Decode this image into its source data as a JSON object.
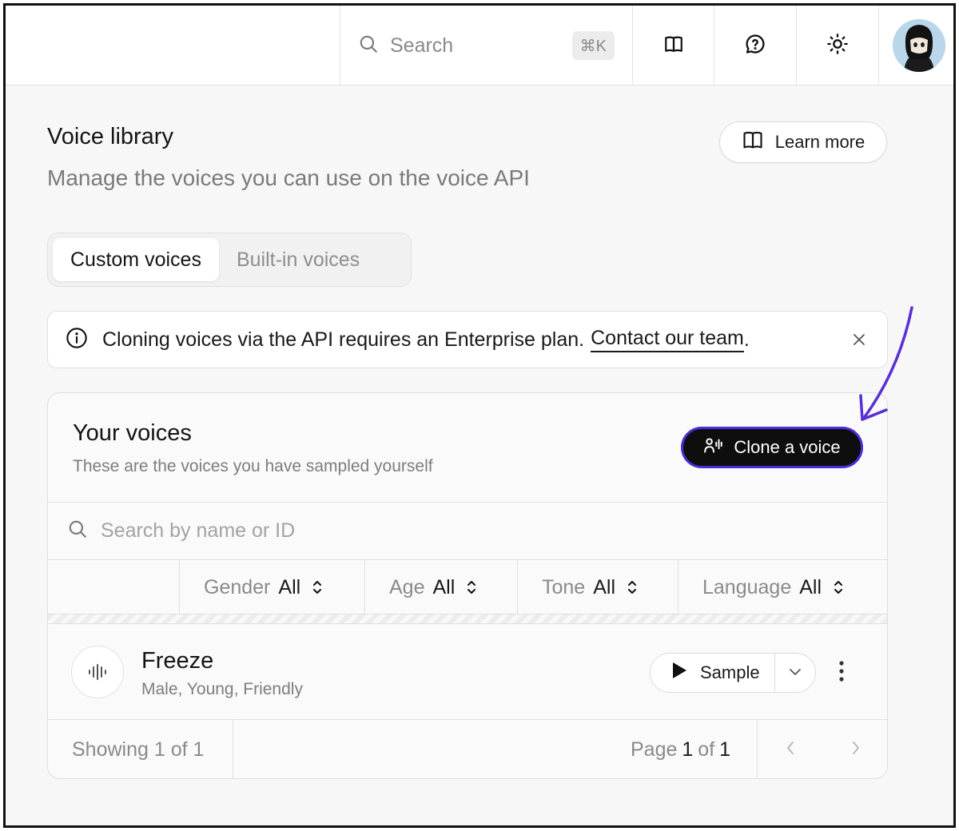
{
  "topbar": {
    "search_label": "Search",
    "shortcut": "⌘K",
    "icons": [
      "book-icon",
      "help-chat-icon",
      "sun-icon"
    ],
    "avatar_alt": "User avatar"
  },
  "header": {
    "title": "Voice library",
    "subtitle": "Manage the voices you can use on the voice API",
    "learn_more": "Learn more"
  },
  "tabs": [
    {
      "label": "Custom voices",
      "active": true
    },
    {
      "label": "Built-in voices",
      "active": false
    }
  ],
  "banner": {
    "text": "Cloning voices via the API requires an Enterprise plan.",
    "link": "Contact our team",
    "suffix": "."
  },
  "voices_card": {
    "title": "Your voices",
    "subtitle": "These are the voices you have sampled yourself",
    "clone_button": "Clone a voice",
    "search_placeholder": "Search by name or ID",
    "filters": [
      {
        "label": "Gender",
        "value": "All"
      },
      {
        "label": "Age",
        "value": "All"
      },
      {
        "label": "Tone",
        "value": "All"
      },
      {
        "label": "Language",
        "value": "All"
      }
    ],
    "voices": [
      {
        "name": "Freeze",
        "meta": "Male, Young, Friendly",
        "sample_label": "Sample"
      }
    ],
    "footer": {
      "showing": "Showing 1 of 1",
      "page_label": "Page",
      "page_current": "1",
      "page_of": "of",
      "page_total": "1"
    }
  },
  "colors": {
    "accent": "#4c2bd8",
    "button_bg": "#0e0e0e",
    "annotation_arrow": "#5a2fd6"
  }
}
